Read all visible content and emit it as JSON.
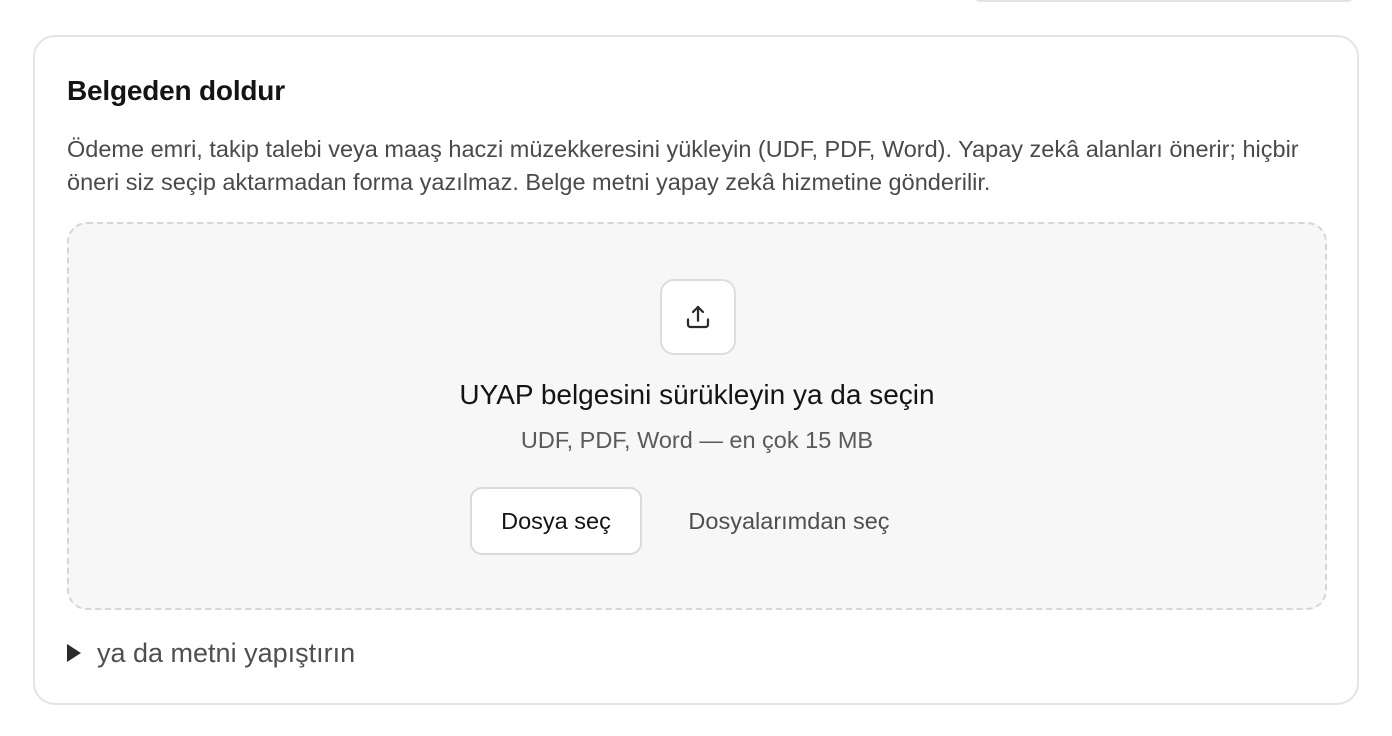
{
  "section": {
    "title": "Belgeden doldur",
    "description": "Ödeme emri, takip talebi veya maaş haczi müzekkeresini yükleyin (UDF, PDF, Word). Yapay zekâ alanları önerir; hiçbir öneri siz seçip aktarmadan forma yazılmaz. Belge metni yapay zekâ hizmetine gönderilir."
  },
  "dropzone": {
    "icon": "upload-icon",
    "title": "UYAP belgesini sürükleyin ya da seçin",
    "hint": "UDF, PDF, Word — en çok 15 MB",
    "choose_file_label": "Dosya seç",
    "choose_from_files_label": "Dosyalarımdan seç"
  },
  "paste": {
    "icon": "disclosure-triangle-icon",
    "label": "ya da metni yapıştırın"
  }
}
